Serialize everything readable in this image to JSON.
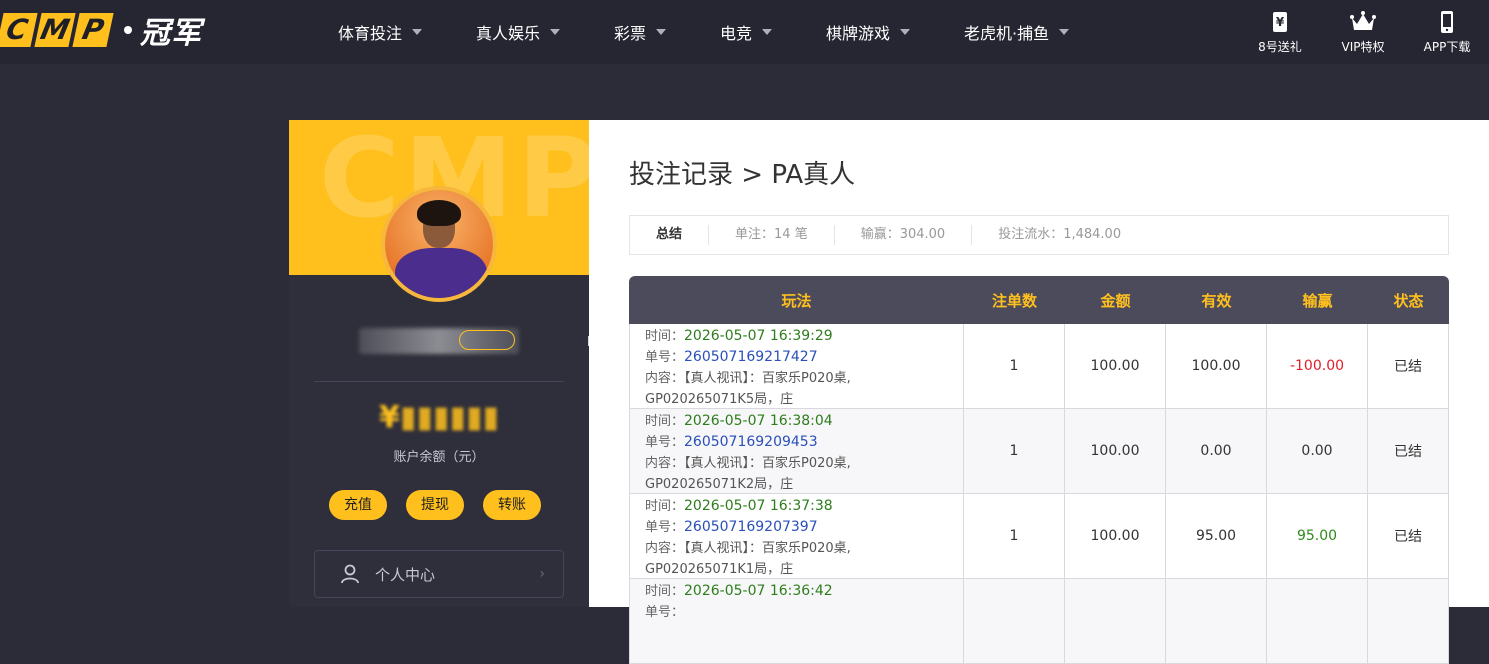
{
  "logo": {
    "letters": [
      "C",
      "M",
      "P"
    ],
    "brand": "冠军"
  },
  "nav": [
    {
      "label": "体育投注"
    },
    {
      "label": "真人娱乐"
    },
    {
      "label": "彩票"
    },
    {
      "label": "电竞"
    },
    {
      "label": "棋牌游戏"
    },
    {
      "label": "老虎机·捕鱼"
    }
  ],
  "quick_links": [
    {
      "label": "8号送礼",
      "icon": "yen-ticket-icon"
    },
    {
      "label": "VIP特权",
      "icon": "crown-icon"
    },
    {
      "label": "APP下载",
      "icon": "phone-icon"
    }
  ],
  "sidebar": {
    "banner_watermark": "CMP",
    "balance_text": "¥",
    "balance_label": "账户余额（元）",
    "buttons": [
      "充值",
      "提现",
      "转账"
    ],
    "menu": [
      {
        "label": "个人中心",
        "icon": "user-icon"
      }
    ]
  },
  "main": {
    "title": "投注记录 > PA真人",
    "summary": {
      "head": "总结",
      "count": "单注：14 笔",
      "win_loss": "输赢：304.00",
      "turnover": "投注流水：1,484.00"
    },
    "table": {
      "headers": [
        "玩法",
        "注单数",
        "金额",
        "有效",
        "输赢",
        "状态"
      ],
      "labels": {
        "time": "时间：",
        "order": "单号：",
        "content": "内容："
      },
      "rows": [
        {
          "time": "2026-05-07 16:39:29",
          "order": "260507169217427",
          "content_line1": "【真人视讯】：百家乐P020桌,",
          "content_line2": "GP020265071K5局，庄",
          "count": "1",
          "amount": "100.00",
          "valid": "100.00",
          "win": "-100.00",
          "status": "已结"
        },
        {
          "time": "2026-05-07 16:38:04",
          "order": "260507169209453",
          "content_line1": "【真人视讯】：百家乐P020桌,",
          "content_line2": "GP020265071K2局，庄",
          "count": "1",
          "amount": "100.00",
          "valid": "0.00",
          "win": "0.00",
          "status": "已结"
        },
        {
          "time": "2026-05-07 16:37:38",
          "order": "260507169207397",
          "content_line1": "【真人视讯】：百家乐P020桌,",
          "content_line2": "GP020265071K1局，庄",
          "count": "1",
          "amount": "100.00",
          "valid": "95.00",
          "win": "95.00",
          "status": "已结"
        },
        {
          "time": "2026-05-07 16:36:42",
          "order": "",
          "content_line1": "",
          "content_line2": "",
          "count": "",
          "amount": "",
          "valid": "",
          "win": "",
          "status": ""
        }
      ]
    }
  },
  "colors": {
    "accent": "#ffc01e",
    "topbar": "#262633",
    "page_bg": "#2c2c38",
    "table_header": "#4b4b5c",
    "negative": "#e0202a",
    "positive": "#2e8b1c"
  }
}
